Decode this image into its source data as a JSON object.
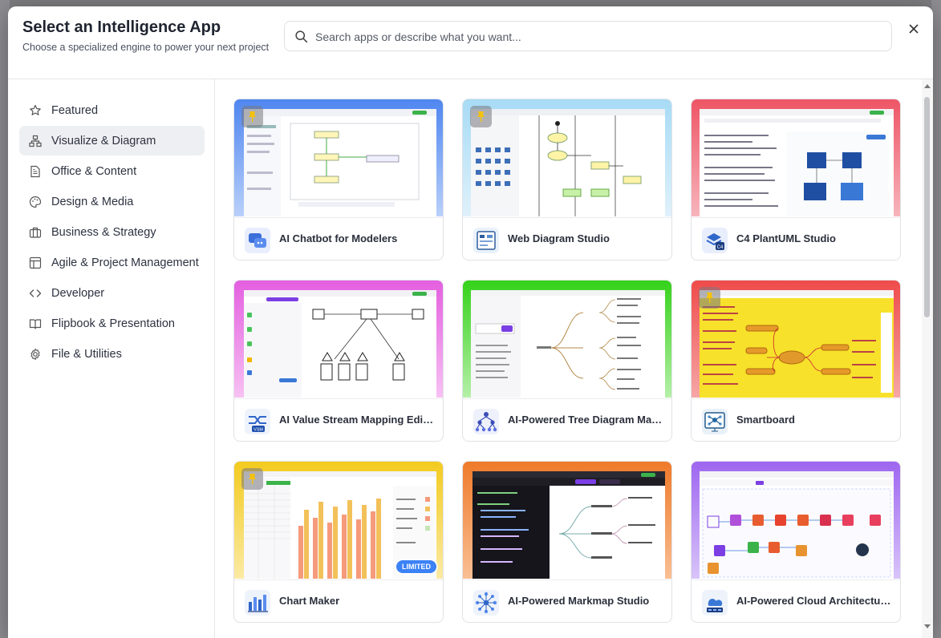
{
  "modal": {
    "title": "Select an Intelligence App",
    "subtitle": "Choose a specialized engine to power your next project",
    "search_placeholder": "Search apps or describe what you want..."
  },
  "sidebar": {
    "items": [
      {
        "label": "Featured",
        "icon": "star-icon",
        "active": false
      },
      {
        "label": "Visualize & Diagram",
        "icon": "diagram-icon",
        "active": true
      },
      {
        "label": "Office & Content",
        "icon": "document-icon",
        "active": false
      },
      {
        "label": "Design & Media",
        "icon": "palette-icon",
        "active": false
      },
      {
        "label": "Business & Strategy",
        "icon": "briefcase-icon",
        "active": false
      },
      {
        "label": "Agile & Project Management",
        "icon": "kanban-icon",
        "active": false
      },
      {
        "label": "Developer",
        "icon": "code-icon",
        "active": false
      },
      {
        "label": "Flipbook & Presentation",
        "icon": "book-icon",
        "active": false
      },
      {
        "label": "File & Utilities",
        "icon": "gear-icon",
        "active": false
      }
    ]
  },
  "apps": [
    {
      "name": "AI Chatbot for Modelers",
      "pinned": true,
      "accent": "#5b8def"
    },
    {
      "name": "Web Diagram Studio",
      "pinned": true,
      "accent": "#9fd3f2"
    },
    {
      "name": "C4 PlantUML Studio",
      "pinned": false,
      "accent": "#ee5a6a"
    },
    {
      "name": "AI Value Stream Mapping Editor",
      "pinned": false,
      "accent": "#e45fe0"
    },
    {
      "name": "AI-Powered Tree Diagram Maker",
      "pinned": false,
      "accent": "#3ad21e"
    },
    {
      "name": "Smartboard",
      "pinned": true,
      "accent": "#ef5050"
    },
    {
      "name": "Chart Maker",
      "pinned": true,
      "accent": "#f2cc22",
      "badge": "LIMITED"
    },
    {
      "name": "AI-Powered Markmap Studio",
      "pinned": false,
      "accent": "#f07b2c"
    },
    {
      "name": "AI-Powered Cloud Architecture Studio",
      "pinned": false,
      "accent": "#a06cf0"
    }
  ]
}
